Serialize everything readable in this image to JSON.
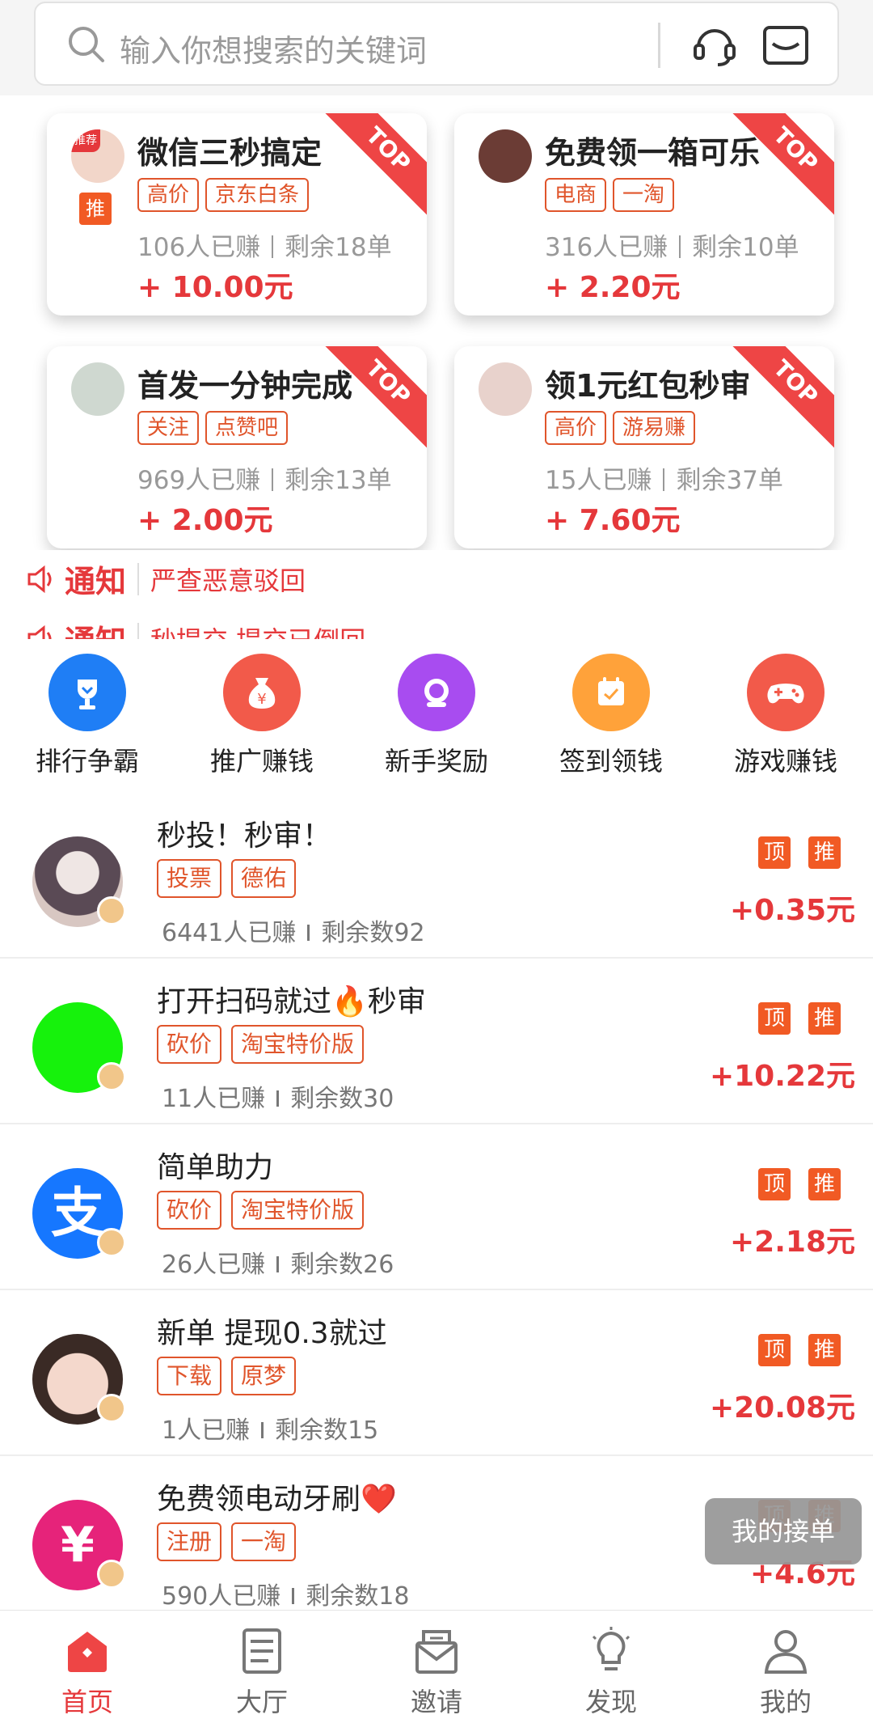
{
  "search": {
    "placeholder": "输入你想搜索的关键词"
  },
  "top_cards": [
    {
      "title": "微信三秒搞定",
      "tags": [
        "高价",
        "京东白条"
      ],
      "earned": "106人已赚",
      "remaining": "剩余18单",
      "reward": "+ 10.00元",
      "ribbon": "TOP",
      "avatar_badge": "推荐",
      "promo_badge": "推"
    },
    {
      "title": "免费领一箱可乐",
      "tags": [
        "电商",
        "一淘"
      ],
      "earned": "316人已赚",
      "remaining": "剩余10单",
      "reward": "+ 2.20元",
      "ribbon": "TOP"
    },
    {
      "title": "首发一分钟完成",
      "tags": [
        "关注",
        "点赞吧"
      ],
      "earned": "969人已赚",
      "remaining": "剩余13单",
      "reward": "+ 2.00元",
      "ribbon": "TOP"
    },
    {
      "title": "领1元红包秒审",
      "tags": [
        "高价",
        "游易赚"
      ],
      "earned": "15人已赚",
      "remaining": "剩余37单",
      "reward": "+ 7.60元",
      "ribbon": "TOP"
    }
  ],
  "notice": {
    "label": "通知",
    "items": [
      "严查恶意驳回",
      "秒提交 提交已倒回"
    ]
  },
  "menu": [
    {
      "label": "排行争霸",
      "color": "#1f7ef5",
      "icon": "trophy-icon"
    },
    {
      "label": "推广赚钱",
      "color": "#f25a4a",
      "icon": "money-bag-icon"
    },
    {
      "label": "新手奖励",
      "color": "#a84cf0",
      "icon": "gift-icon"
    },
    {
      "label": "签到领钱",
      "color": "#ffa23a",
      "icon": "calendar-icon"
    },
    {
      "label": "游戏赚钱",
      "color": "#f25a4a",
      "icon": "gamepad-icon"
    }
  ],
  "tasks": [
    {
      "title": "秒投！秒审！",
      "tags": [
        "投票",
        "德佑"
      ],
      "earned": "6441人已赚",
      "remaining": "剩余数92",
      "reward": "+0.35元",
      "badges": [
        "顶",
        "推"
      ],
      "avatar_color": "#d8c7c2"
    },
    {
      "title": "打开扫码就过🔥秒审",
      "tags": [
        "砍价",
        "淘宝特价版"
      ],
      "earned": "11人已赚",
      "remaining": "剩余数30",
      "reward": "+10.22元",
      "badges": [
        "顶",
        "推"
      ],
      "avatar_color": "#16f20c"
    },
    {
      "title": "简单助力",
      "tags": [
        "砍价",
        "淘宝特价版"
      ],
      "earned": "26人已赚",
      "remaining": "剩余数26",
      "reward": "+2.18元",
      "badges": [
        "顶",
        "推"
      ],
      "avatar_color": "#1677ff",
      "avatar_glyph": "支"
    },
    {
      "title": "新单 提现0.3就过",
      "tags": [
        "下载",
        "原梦"
      ],
      "earned": "1人已赚",
      "remaining": "剩余数15",
      "reward": "+20.08元",
      "badges": [
        "顶",
        "推"
      ],
      "avatar_color": "#e9c4b4"
    },
    {
      "title": "免费领电动牙刷❤️",
      "tags": [
        "注册",
        "一淘"
      ],
      "earned": "590人已赚",
      "remaining": "剩余数18",
      "reward": "+4.6元",
      "badges": [
        "顶",
        "推"
      ],
      "avatar_color": "#e6237a",
      "avatar_glyph": "¥"
    }
  ],
  "float_button": "我的接单",
  "bottom_nav": [
    {
      "label": "首页",
      "icon": "home-icon",
      "active": true
    },
    {
      "label": "大厅",
      "icon": "list-icon",
      "active": false
    },
    {
      "label": "邀请",
      "icon": "invite-envelope-icon",
      "active": false
    },
    {
      "label": "发现",
      "icon": "lightbulb-icon",
      "active": false
    },
    {
      "label": "我的",
      "icon": "user-icon",
      "active": false
    }
  ],
  "colors": {
    "accent": "#e5383b",
    "tag": "#e0552b",
    "badge": "#f15a24"
  }
}
